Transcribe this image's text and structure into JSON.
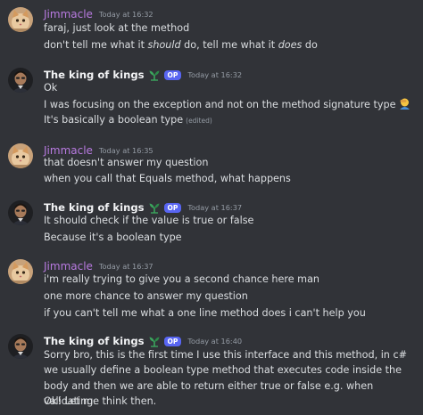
{
  "messages": [
    {
      "author": "Jimmacle",
      "timestamp": "Today at 16:32",
      "lines": [
        "faraj, just look at the method"
      ],
      "line2": {
        "a": "don't tell me what it ",
        "b": "should",
        "c": " do, tell me what it ",
        "d": "does",
        "e": " do"
      }
    },
    {
      "author": "The king of kings",
      "badge": "OP",
      "timestamp": "Today at 16:32",
      "lines": [
        "Ok",
        "I was focusing on the exception and not on the method signature type",
        "It's basically a boolean type"
      ],
      "edited": "(edited)",
      "emoji": "facepalm-emoji"
    },
    {
      "author": "Jimmacle",
      "timestamp": "Today at 16:35",
      "lines": [
        "that doesn't answer my question",
        "when you call that Equals method, what happens"
      ]
    },
    {
      "author": "The king of kings",
      "badge": "OP",
      "timestamp": "Today at 16:37",
      "lines": [
        "It should check if the value is true or false",
        "Because it's a boolean type"
      ]
    },
    {
      "author": "Jimmacle",
      "timestamp": "Today at 16:37",
      "lines": [
        "i'm really trying to give you a second chance here man",
        "one more chance to answer my question",
        "if you can't tell me what a one line method does i can't help you"
      ]
    },
    {
      "author": "The king of kings",
      "badge": "OP",
      "timestamp": "Today at 16:40",
      "lines": [
        "Sorry bro, this is the first time I use this interface and this method, in c# we usually define a boolean type method that executes code inside the body and then we are able to return either true or false e.g. when validating.",
        "Ok! Let me think then."
      ]
    }
  ],
  "colors": {
    "background": "#313338",
    "jimmacle_name": "#b87ae0",
    "king_name": "#f2f3f5",
    "op_badge": "#5865f2",
    "timestamp": "#949ba4",
    "text": "#dbdee1"
  },
  "icons": {
    "role_icon": "sprout-icon"
  }
}
